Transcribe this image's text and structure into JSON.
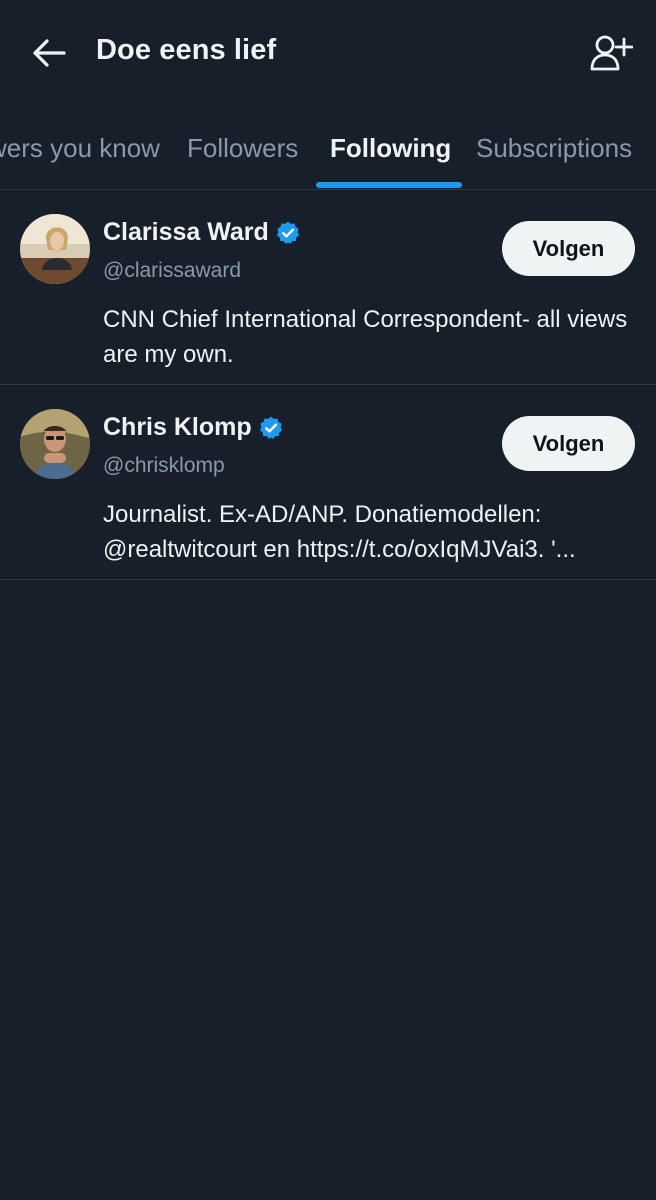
{
  "header": {
    "title": "Doe eens lief",
    "back_icon": "arrow-left-icon",
    "add_user_icon": "person-plus-icon"
  },
  "tabs": [
    {
      "label": "wers you know",
      "active": false
    },
    {
      "label": "Followers",
      "active": false
    },
    {
      "label": "Following",
      "active": true
    },
    {
      "label": "Subscriptions",
      "active": false
    }
  ],
  "users": [
    {
      "name": "Clarissa Ward",
      "handle": "@clarissaward",
      "verified": true,
      "bio": "CNN Chief International Correspondent- all views are my own.",
      "follow_label": "Volgen"
    },
    {
      "name": "Chris Klomp",
      "handle": "@chrisklomp",
      "verified": true,
      "bio": "Journalist. Ex-AD/ANP. Donatiemodellen: @realtwitcourt en https://t.co/oxIqMJVai3. '...",
      "follow_label": "Volgen"
    }
  ],
  "colors": {
    "background": "#17202a",
    "accent": "#1d9bf0",
    "muted_text": "#8b98a5",
    "button_bg": "#eff3f4"
  }
}
